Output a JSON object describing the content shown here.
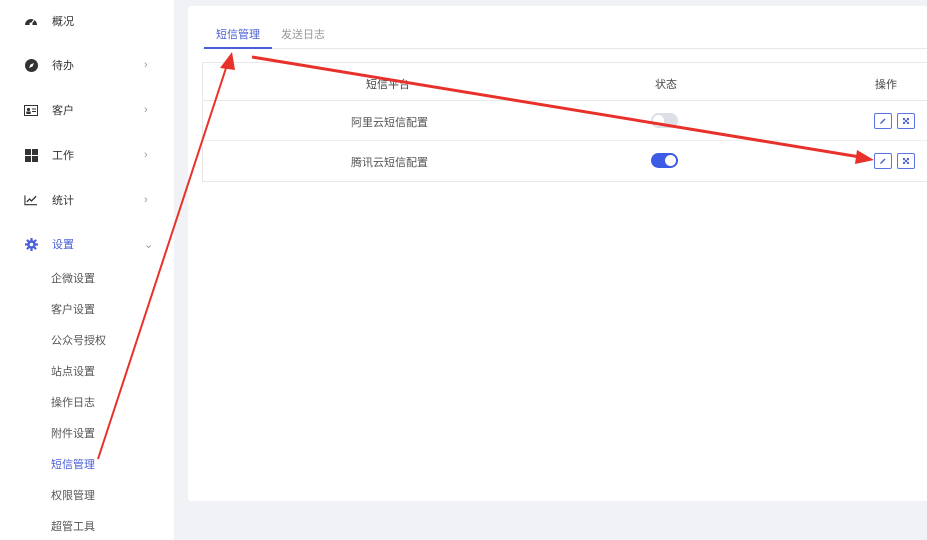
{
  "sidebar": {
    "items": [
      {
        "label": "概况",
        "icon": "dashboard-icon"
      },
      {
        "label": "待办",
        "icon": "compass-icon",
        "chevron": "›"
      },
      {
        "label": "客户",
        "icon": "contact-card-icon",
        "chevron": "›"
      },
      {
        "label": "工作",
        "icon": "grid-icon",
        "chevron": "›"
      },
      {
        "label": "统计",
        "icon": "line-chart-icon",
        "chevron": "›"
      },
      {
        "label": "设置",
        "icon": "gear-icon",
        "chevron": "⌄"
      }
    ],
    "sub_items": [
      "企微设置",
      "客户设置",
      "公众号授权",
      "站点设置",
      "操作日志",
      "附件设置",
      "短信管理",
      "权限管理",
      "超管工具"
    ]
  },
  "tabs": [
    "短信管理",
    "发送日志"
  ],
  "table": {
    "headers": [
      "短信平台",
      "状态",
      "操作"
    ],
    "rows": [
      {
        "name": "阿里云短信配置",
        "enabled": false
      },
      {
        "name": "腾讯云短信配置",
        "enabled": true
      }
    ]
  },
  "colors": {
    "accent": "#4a5fd6",
    "switch_on": "#3d5ce6",
    "annotation_arrow": "#e8312a"
  }
}
